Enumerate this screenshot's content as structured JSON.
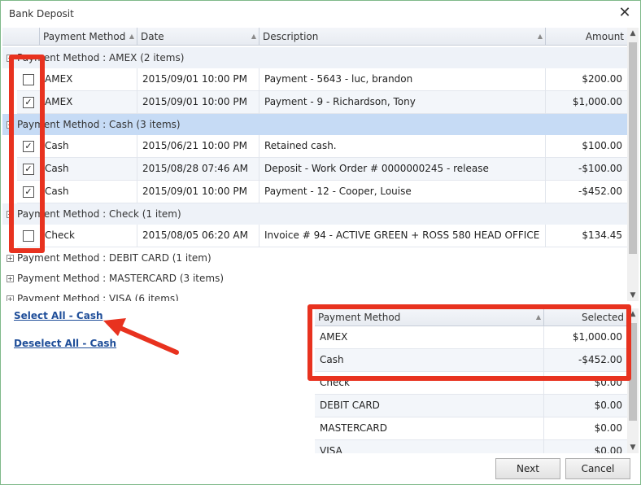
{
  "window": {
    "title": "Bank Deposit",
    "close_glyph": "✕"
  },
  "grid": {
    "columns": {
      "payment_method": "Payment Method",
      "date": "Date",
      "description": "Description",
      "amount": "Amount"
    },
    "groups": [
      {
        "label": "Payment Method : AMEX (2 items)",
        "expanded": true,
        "rows": [
          {
            "checked": false,
            "method": "AMEX",
            "date": "2015/09/01 10:00 PM",
            "description": "Payment - 5643 - luc, brandon",
            "amount": "$200.00"
          },
          {
            "checked": true,
            "method": "AMEX",
            "date": "2015/09/01 10:00 PM",
            "description": "Payment - 9 - Richardson, Tony",
            "amount": "$1,000.00"
          }
        ]
      },
      {
        "label": "Payment Method : Cash (3 items)",
        "expanded": true,
        "rows": [
          {
            "checked": true,
            "method": "Cash",
            "date": "2015/06/21 10:00 PM",
            "description": "Retained cash.",
            "amount": "$100.00"
          },
          {
            "checked": true,
            "method": "Cash",
            "date": "2015/08/28 07:46 AM",
            "description": "Deposit - Work Order # 0000000245 - release",
            "amount": "-$100.00"
          },
          {
            "checked": true,
            "method": "Cash",
            "date": "2015/09/01 10:00 PM",
            "description": "Payment - 12 - Cooper, Louise",
            "amount": "-$452.00"
          }
        ]
      },
      {
        "label": "Payment Method : Check (1 item)",
        "expanded": true,
        "rows": [
          {
            "checked": false,
            "method": "Check",
            "date": "2015/08/05 06:20 AM",
            "description": "Invoice # 94 - ACTIVE GREEN + ROSS 580 HEAD OFFICE",
            "amount": "$134.45"
          }
        ]
      },
      {
        "label": "Payment Method : DEBIT CARD (1 item)",
        "expanded": false,
        "rows": []
      },
      {
        "label": "Payment Method : MASTERCARD (3 items)",
        "expanded": false,
        "rows": []
      },
      {
        "label": "Payment Method : VISA (6 items)",
        "expanded": false,
        "rows": []
      }
    ]
  },
  "links": {
    "select_all": "Select All - Cash",
    "deselect_all": "Deselect All - Cash"
  },
  "summary": {
    "columns": {
      "payment_method": "Payment Method",
      "selected": "Selected"
    },
    "rows": [
      {
        "method": "AMEX",
        "selected": "$1,000.00"
      },
      {
        "method": "Cash",
        "selected": "-$452.00"
      },
      {
        "method": "Check",
        "selected": "$0.00"
      },
      {
        "method": "DEBIT CARD",
        "selected": "$0.00"
      },
      {
        "method": "MASTERCARD",
        "selected": "$0.00"
      },
      {
        "method": "VISA",
        "selected": "$0.00"
      }
    ]
  },
  "buttons": {
    "next": "Next",
    "cancel": "Cancel"
  },
  "colors": {
    "annotation": "#e8321f",
    "link": "#1f4e99",
    "selected_group": "#c6dbf5"
  }
}
